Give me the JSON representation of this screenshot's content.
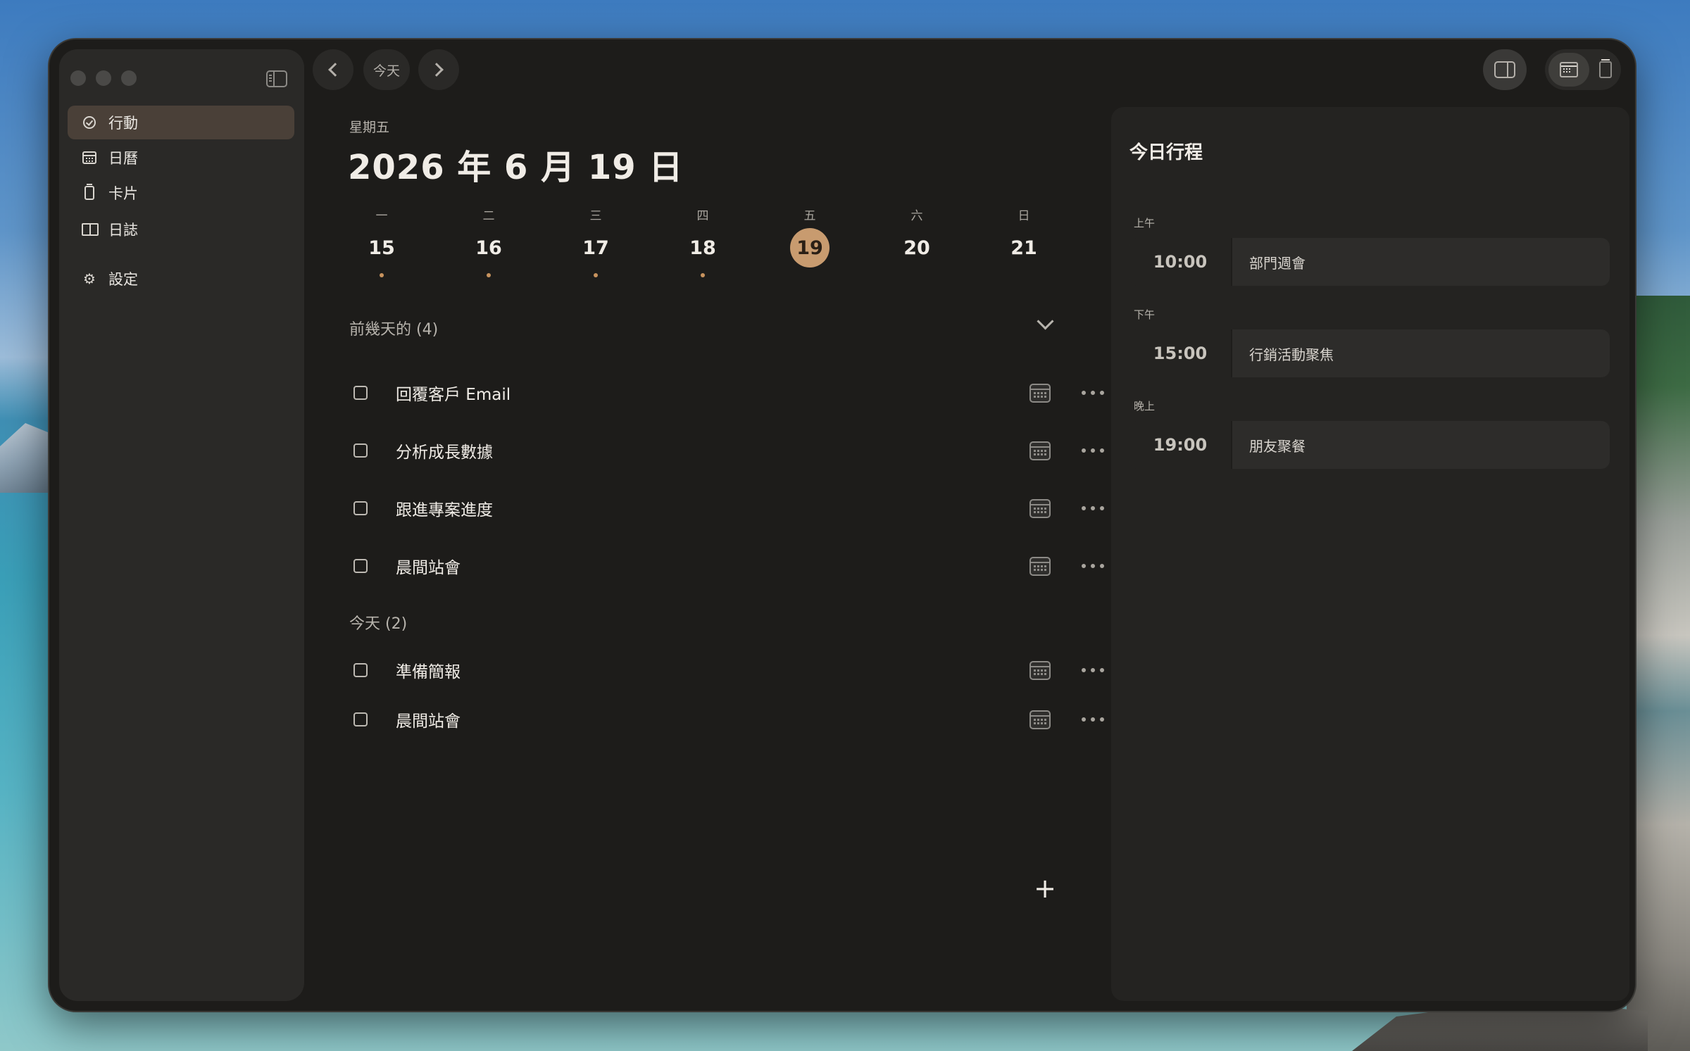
{
  "sidebar": {
    "items": [
      {
        "label": "行動",
        "icon": "check-circle-icon",
        "active": true
      },
      {
        "label": "日曆",
        "icon": "calendar-icon",
        "active": false
      },
      {
        "label": "卡片",
        "icon": "card-icon",
        "active": false
      },
      {
        "label": "日誌",
        "icon": "book-icon",
        "active": false
      }
    ],
    "settings": {
      "label": "設定",
      "icon": "gear-icon"
    }
  },
  "toolbar": {
    "today_label": "今天",
    "back_icon": "chevron-left-icon",
    "forward_icon": "chevron-right-icon"
  },
  "main": {
    "weekday": "星期五",
    "date": "2026 年 6 月 19 日",
    "week": [
      {
        "dow": "一",
        "day": "15",
        "dot": true,
        "today": false
      },
      {
        "dow": "二",
        "day": "16",
        "dot": true,
        "today": false
      },
      {
        "dow": "三",
        "day": "17",
        "dot": true,
        "today": false
      },
      {
        "dow": "四",
        "day": "18",
        "dot": true,
        "today": false
      },
      {
        "dow": "五",
        "day": "19",
        "dot": false,
        "today": true
      },
      {
        "dow": "六",
        "day": "20",
        "dot": false,
        "today": false
      },
      {
        "dow": "日",
        "day": "21",
        "dot": false,
        "today": false
      }
    ],
    "previous_section": {
      "label": "前幾天的 (4)",
      "tasks": [
        "回覆客戶 Email",
        "分析成長數據",
        "跟進專案進度",
        "晨間站會"
      ]
    },
    "today_section": {
      "label": "今天 (2)",
      "tasks": [
        "準備簡報",
        "晨間站會"
      ]
    },
    "add_button": "+"
  },
  "panel": {
    "title": "今日行程",
    "groups": [
      {
        "period": "上午",
        "time": "10:00",
        "title": "部門週會"
      },
      {
        "period": "下午",
        "time": "15:00",
        "title": "行銷活動聚焦"
      },
      {
        "period": "晚上",
        "time": "19:00",
        "title": "朋友聚餐"
      }
    ]
  },
  "colors": {
    "accent": "#c89b6f",
    "dot": "#c8935e",
    "window_bg": "#1d1c1a",
    "sidebar_bg": "#2a2927",
    "active_item_bg": "#4a4038"
  }
}
